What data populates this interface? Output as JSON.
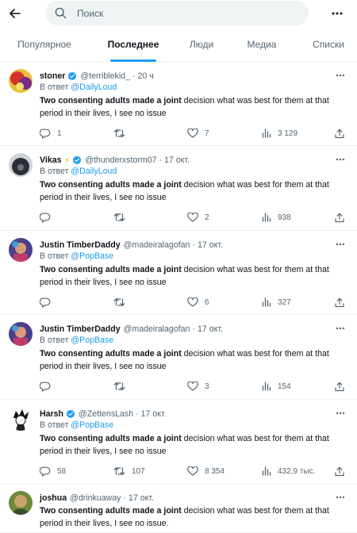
{
  "search": {
    "placeholder": "Поиск"
  },
  "tabs": [
    {
      "label": "Популярное",
      "active": false
    },
    {
      "label": "Последнее",
      "active": true
    },
    {
      "label": "Люди",
      "active": false
    },
    {
      "label": "Медиа",
      "active": false
    },
    {
      "label": "Списки",
      "active": false
    }
  ],
  "reply_prefix": "В ответ",
  "colors": {
    "accent": "#1d9bf0",
    "text": "#0f1419",
    "muted": "#536471",
    "divider": "#eff3f4"
  },
  "tweets": [
    {
      "name": "stoner",
      "emoji": "",
      "verified": true,
      "handle": "@terriblekid_",
      "time": "20 ч",
      "reply_to": "@DailyLoud",
      "text_bold": "Two consenting adults made a joint",
      "text_rest": " decision what was best for them at that period in their lives, I see no issue",
      "replies": "1",
      "retweets": "",
      "likes": "7",
      "views": "3 129"
    },
    {
      "name": "Vikas",
      "emoji": "⚡",
      "verified": true,
      "handle": "@thunderxstorm07",
      "time": "17 окт.",
      "reply_to": "@DailyLoud",
      "text_bold": "Two consenting adults made a joint",
      "text_rest": " decision what was best for them at that period in their lives, I see no issue",
      "replies": "",
      "retweets": "",
      "likes": "2",
      "views": "938"
    },
    {
      "name": "Justin TimberDaddy",
      "emoji": "",
      "verified": false,
      "handle": "@madeiralagofan",
      "time": "17 окт.",
      "reply_to": "@PopBase",
      "text_bold": "Two consenting adults made a joint",
      "text_rest": " decision what was best for them at that period in their lives, I see no issue",
      "replies": "",
      "retweets": "",
      "likes": "6",
      "views": "327"
    },
    {
      "name": "Justin TimberDaddy",
      "emoji": "",
      "verified": false,
      "handle": "@madeiralagofan",
      "time": "17 окт.",
      "reply_to": "@PopBase",
      "text_bold": "Two consenting adults made a joint",
      "text_rest": " decision what was best for them at that period in their lives, I see no issue",
      "replies": "",
      "retweets": "",
      "likes": "3",
      "views": "154"
    },
    {
      "name": "Harsh",
      "emoji": "",
      "verified": true,
      "handle": "@ZettensLash",
      "time": "17 окт.",
      "reply_to": "@PopBase",
      "text_bold": "Two consenting adults made a joint",
      "text_rest": " decision what was best for them at that period in their lives, I see no issue",
      "replies": "58",
      "retweets": "107",
      "likes": "8 354",
      "views": "432,9 тыс."
    },
    {
      "name": "joshua",
      "emoji": "",
      "verified": false,
      "handle": "@drinkuaway",
      "time": "17 окт.",
      "reply_to": "",
      "text_bold": "Two consenting adults made a joint",
      "text_rest": " decision what was best for them at that period in their lives, I see no issue.",
      "replies": "",
      "retweets": "",
      "likes": "",
      "views": ""
    }
  ]
}
